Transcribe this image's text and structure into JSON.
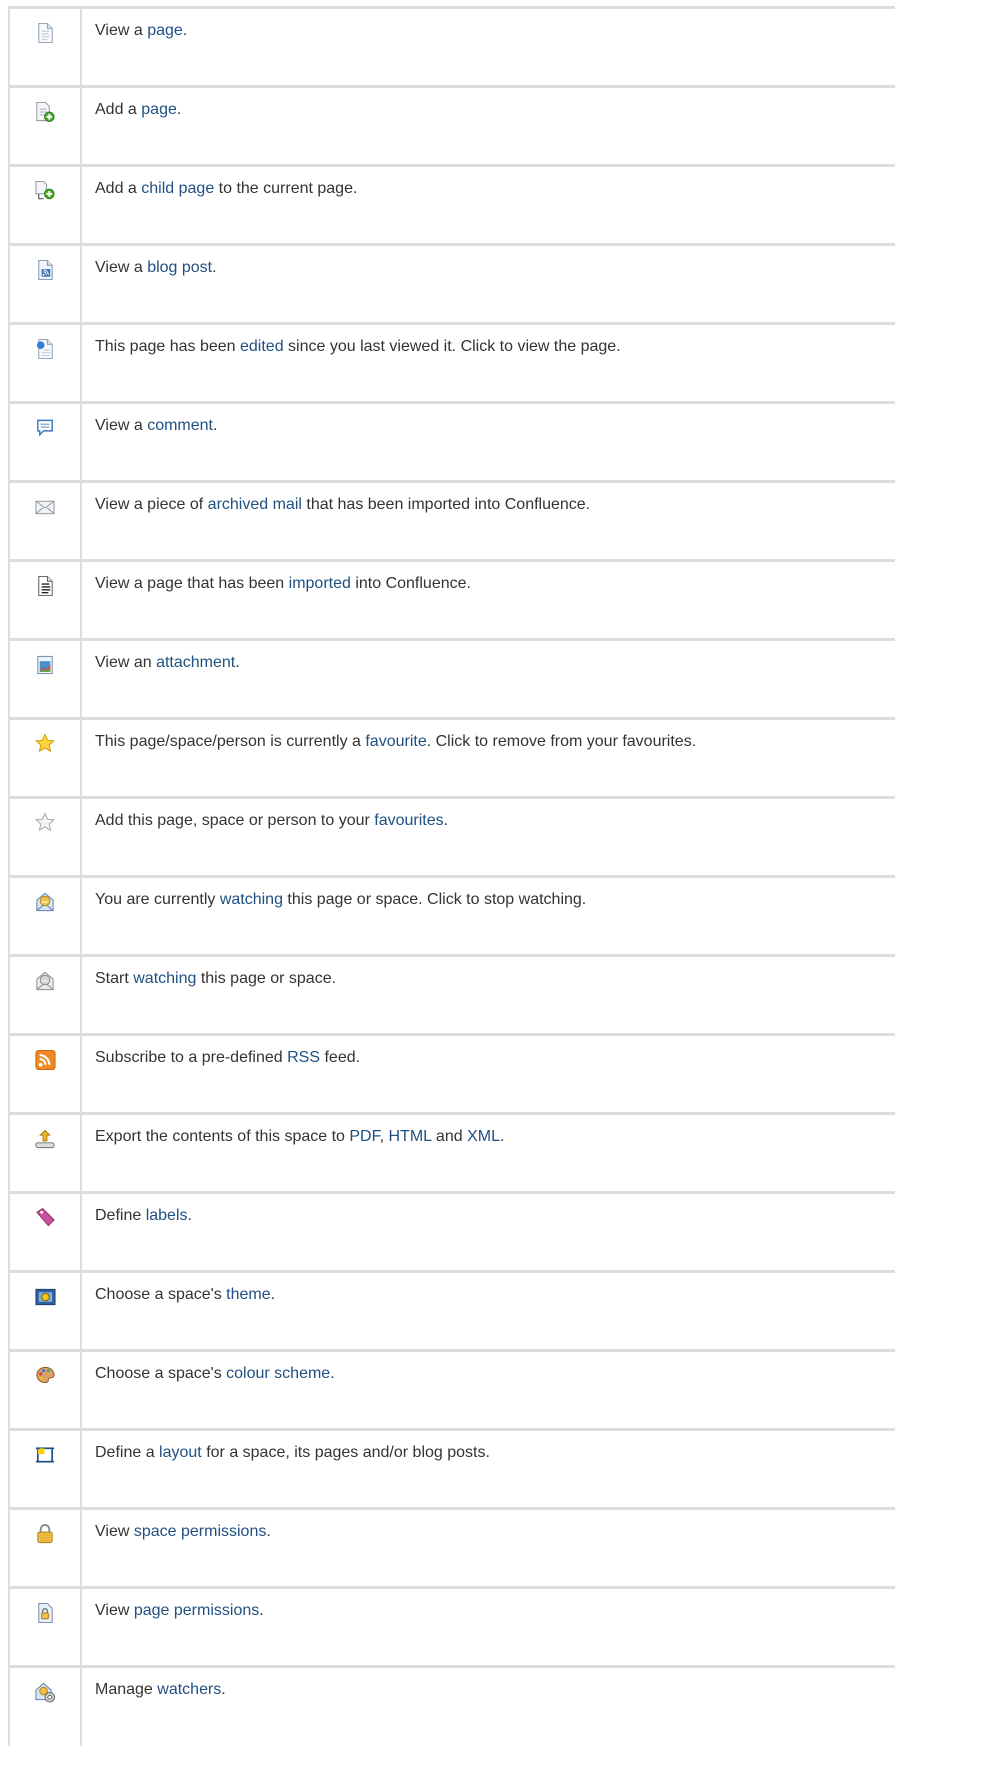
{
  "rows": [
    {
      "icon": "page-icon",
      "parts": [
        {
          "t": "View a "
        },
        {
          "t": "page",
          "link": true
        },
        {
          "t": "."
        }
      ]
    },
    {
      "icon": "add-page-icon",
      "parts": [
        {
          "t": "Add a "
        },
        {
          "t": "page",
          "link": true
        },
        {
          "t": "."
        }
      ]
    },
    {
      "icon": "add-child-page-icon",
      "parts": [
        {
          "t": "Add a "
        },
        {
          "t": "child page",
          "link": true
        },
        {
          "t": " to the current page."
        }
      ]
    },
    {
      "icon": "blog-post-icon",
      "parts": [
        {
          "t": "View a "
        },
        {
          "t": "blog post",
          "link": true
        },
        {
          "t": "."
        }
      ]
    },
    {
      "icon": "edited-page-icon",
      "parts": [
        {
          "t": "This page has been "
        },
        {
          "t": "edited",
          "link": true
        },
        {
          "t": " since you last viewed it. Click to view the page."
        }
      ]
    },
    {
      "icon": "comment-icon",
      "parts": [
        {
          "t": "View a "
        },
        {
          "t": "comment",
          "link": true
        },
        {
          "t": "."
        }
      ]
    },
    {
      "icon": "mail-icon",
      "parts": [
        {
          "t": "View a piece of "
        },
        {
          "t": "archived mail",
          "link": true
        },
        {
          "t": " that has been imported into Confluence."
        }
      ]
    },
    {
      "icon": "imported-page-icon",
      "parts": [
        {
          "t": "View a page that has been "
        },
        {
          "t": "imported",
          "link": true
        },
        {
          "t": " into Confluence."
        }
      ]
    },
    {
      "icon": "attachment-icon",
      "parts": [
        {
          "t": "View an "
        },
        {
          "t": "attachment",
          "link": true
        },
        {
          "t": "."
        }
      ]
    },
    {
      "icon": "star-filled-icon",
      "parts": [
        {
          "t": "This page/space/person is currently a "
        },
        {
          "t": "favourite",
          "link": true
        },
        {
          "t": ". Click to remove from your favourites."
        }
      ]
    },
    {
      "icon": "star-empty-icon",
      "parts": [
        {
          "t": "Add this page, space or person to your "
        },
        {
          "t": "favourites",
          "link": true
        },
        {
          "t": "."
        }
      ]
    },
    {
      "icon": "watching-icon",
      "parts": [
        {
          "t": "You are currently "
        },
        {
          "t": "watching",
          "link": true
        },
        {
          "t": " this page or space. Click to stop watching."
        }
      ]
    },
    {
      "icon": "watch-icon",
      "parts": [
        {
          "t": "Start "
        },
        {
          "t": "watching",
          "link": true
        },
        {
          "t": " this page or space."
        }
      ]
    },
    {
      "icon": "rss-icon",
      "parts": [
        {
          "t": "Subscribe to a pre-defined "
        },
        {
          "t": "RSS",
          "link": true
        },
        {
          "t": " feed."
        }
      ]
    },
    {
      "icon": "export-icon",
      "parts": [
        {
          "t": "Export the contents of this space to "
        },
        {
          "t": "PDF",
          "link": true
        },
        {
          "t": ", "
        },
        {
          "t": "HTML",
          "link": true
        },
        {
          "t": " and "
        },
        {
          "t": "XML",
          "link": true
        },
        {
          "t": "."
        }
      ]
    },
    {
      "icon": "label-icon",
      "parts": [
        {
          "t": "Define "
        },
        {
          "t": "labels",
          "link": true
        },
        {
          "t": "."
        }
      ]
    },
    {
      "icon": "theme-icon",
      "parts": [
        {
          "t": "Choose a space's "
        },
        {
          "t": "theme",
          "link": true
        },
        {
          "t": "."
        }
      ]
    },
    {
      "icon": "colour-scheme-icon",
      "parts": [
        {
          "t": "Choose a space's "
        },
        {
          "t": "colour scheme",
          "link": true
        },
        {
          "t": "."
        }
      ]
    },
    {
      "icon": "layout-icon",
      "parts": [
        {
          "t": "Define a "
        },
        {
          "t": "layout",
          "link": true
        },
        {
          "t": " for a space, its pages and/or blog posts."
        }
      ]
    },
    {
      "icon": "space-permissions-icon",
      "parts": [
        {
          "t": "View "
        },
        {
          "t": "space permissions",
          "link": true
        },
        {
          "t": "."
        }
      ]
    },
    {
      "icon": "page-permissions-icon",
      "parts": [
        {
          "t": "View "
        },
        {
          "t": "page permissions",
          "link": true
        },
        {
          "t": "."
        }
      ]
    },
    {
      "icon": "manage-watchers-icon",
      "parts": [
        {
          "t": "Manage "
        },
        {
          "t": "watchers",
          "link": true
        },
        {
          "t": "."
        }
      ]
    }
  ]
}
